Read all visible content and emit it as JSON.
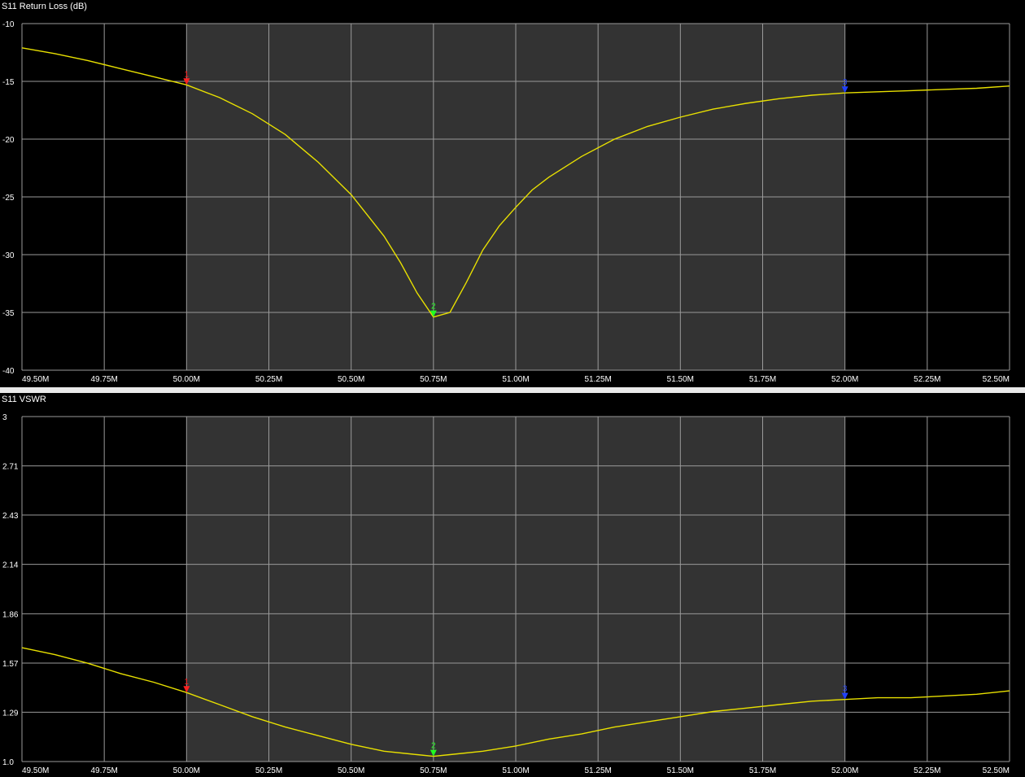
{
  "colors": {
    "background": "#000000",
    "span_shade": "#333333",
    "grid": "#9a9a9a",
    "trace": "#e8e000",
    "marker_1": "#ff2020",
    "marker_2": "#20ff20",
    "marker_3": "#2040ff"
  },
  "chart_data": [
    {
      "type": "line",
      "title": "S11 Return Loss (dB)",
      "xlim": [
        49.5,
        52.5
      ],
      "ylim": [
        -40,
        -10
      ],
      "x_ticks": [
        49.5,
        49.75,
        50.0,
        50.25,
        50.5,
        50.75,
        51.0,
        51.25,
        51.5,
        51.75,
        52.0,
        52.25,
        52.5
      ],
      "x_tick_labels": [
        "49.50M",
        "49.75M",
        "50.00M",
        "50.25M",
        "50.50M",
        "50.75M",
        "51.00M",
        "51.25M",
        "51.50M",
        "51.75M",
        "52.00M",
        "52.25M",
        "52.50M"
      ],
      "y_ticks": [
        -10,
        -15,
        -20,
        -25,
        -30,
        -35,
        -40
      ],
      "y_tick_labels": [
        "-10",
        "-15",
        "-20",
        "-25",
        "-30",
        "-35",
        "-40"
      ],
      "grid": true,
      "shaded_span": [
        50.0,
        52.0
      ],
      "series": [
        {
          "x": [
            49.5,
            49.6,
            49.7,
            49.8,
            49.9,
            50.0,
            50.1,
            50.2,
            50.3,
            50.4,
            50.5,
            50.55,
            50.6,
            50.65,
            50.7,
            50.75,
            50.8,
            50.85,
            50.9,
            50.95,
            51.0,
            51.05,
            51.1,
            51.2,
            51.3,
            51.4,
            51.5,
            51.6,
            51.7,
            51.8,
            51.9,
            52.0,
            52.1,
            52.2,
            52.3,
            52.4,
            52.5
          ],
          "y": [
            -12.1,
            -12.6,
            -13.2,
            -13.9,
            -14.6,
            -15.3,
            -16.4,
            -17.8,
            -19.6,
            -22.0,
            -24.8,
            -26.6,
            -28.4,
            -30.7,
            -33.3,
            -35.4,
            -35.0,
            -32.4,
            -29.6,
            -27.5,
            -25.9,
            -24.4,
            -23.3,
            -21.5,
            -20.0,
            -18.9,
            -18.1,
            -17.4,
            -16.9,
            -16.5,
            -16.2,
            -16.0,
            -15.9,
            -15.8,
            -15.7,
            -15.6,
            -15.4
          ]
        }
      ],
      "markers": [
        {
          "label": "1",
          "x": 50.0,
          "y": -15.3,
          "color": "#ff2020"
        },
        {
          "label": "2",
          "x": 50.75,
          "y": -35.4,
          "color": "#20ff20"
        },
        {
          "label": "3",
          "x": 52.0,
          "y": -16.0,
          "color": "#2040ff"
        }
      ]
    },
    {
      "type": "line",
      "title": "S11 VSWR",
      "xlim": [
        49.5,
        52.5
      ],
      "ylim": [
        1.0,
        3.0
      ],
      "x_ticks": [
        49.5,
        49.75,
        50.0,
        50.25,
        50.5,
        50.75,
        51.0,
        51.25,
        51.5,
        51.75,
        52.0,
        52.25,
        52.5
      ],
      "x_tick_labels": [
        "49.50M",
        "49.75M",
        "50.00M",
        "50.25M",
        "50.50M",
        "50.75M",
        "51.00M",
        "51.25M",
        "51.50M",
        "51.75M",
        "52.00M",
        "52.25M",
        "52.50M"
      ],
      "y_ticks": [
        3.0,
        2.714,
        2.429,
        2.143,
        1.857,
        1.571,
        1.286,
        1.0
      ],
      "y_tick_labels": [
        "3",
        "2.71",
        "2.43",
        "2.14",
        "1.86",
        "1.57",
        "1.29",
        "1.0"
      ],
      "grid": true,
      "shaded_span": [
        50.0,
        52.0
      ],
      "series": [
        {
          "x": [
            49.5,
            49.6,
            49.7,
            49.8,
            49.9,
            50.0,
            50.1,
            50.2,
            50.3,
            50.4,
            50.5,
            50.6,
            50.7,
            50.75,
            50.8,
            50.9,
            51.0,
            51.1,
            51.2,
            51.3,
            51.4,
            51.5,
            51.6,
            51.7,
            51.8,
            51.9,
            52.0,
            52.1,
            52.2,
            52.3,
            52.4,
            52.5
          ],
          "y": [
            1.66,
            1.62,
            1.57,
            1.51,
            1.46,
            1.4,
            1.33,
            1.26,
            1.2,
            1.15,
            1.1,
            1.06,
            1.04,
            1.03,
            1.04,
            1.06,
            1.09,
            1.13,
            1.16,
            1.2,
            1.23,
            1.26,
            1.29,
            1.31,
            1.33,
            1.35,
            1.36,
            1.37,
            1.37,
            1.38,
            1.39,
            1.41
          ]
        }
      ],
      "markers": [
        {
          "label": "1",
          "x": 50.0,
          "y": 1.4,
          "color": "#ff2020"
        },
        {
          "label": "2",
          "x": 50.75,
          "y": 1.03,
          "color": "#20ff20"
        },
        {
          "label": "3",
          "x": 52.0,
          "y": 1.36,
          "color": "#2040ff"
        }
      ]
    }
  ]
}
